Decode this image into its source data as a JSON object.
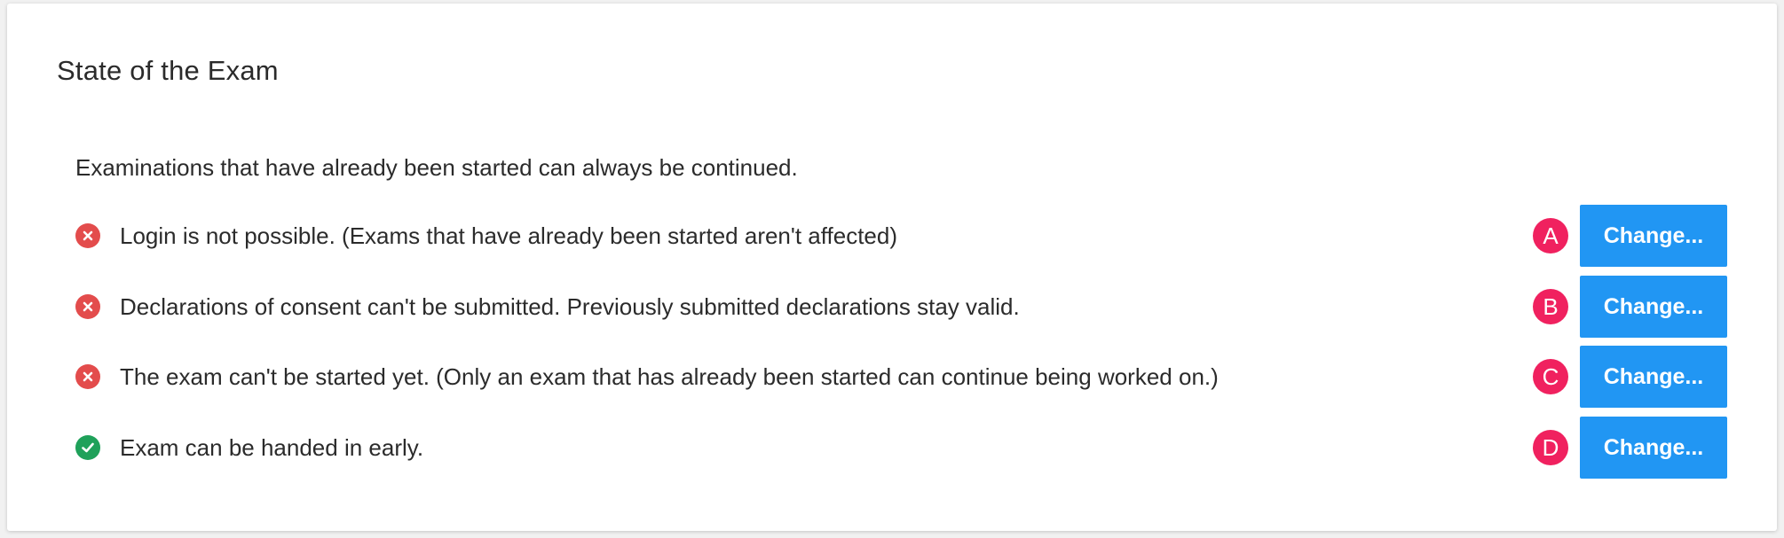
{
  "panel": {
    "title": "State of the Exam",
    "intro": "Examinations that have already been started can always be continued."
  },
  "settings": [
    {
      "status": "disabled",
      "status_icon": "x-circle-icon",
      "text": "Login is not possible. (Exams that have already been started aren't affected)",
      "badge": "A",
      "button_label": "Change..."
    },
    {
      "status": "disabled",
      "status_icon": "x-circle-icon",
      "text": "Declarations of consent can't be submitted. Previously submitted declarations stay valid.",
      "badge": "B",
      "button_label": "Change..."
    },
    {
      "status": "disabled",
      "status_icon": "x-circle-icon",
      "text": "The exam can't be started yet. (Only an exam that has already been started can continue being worked on.)",
      "badge": "C",
      "button_label": "Change..."
    },
    {
      "status": "enabled",
      "status_icon": "check-circle-icon",
      "text": "Exam can be handed in early.",
      "badge": "D",
      "button_label": "Change..."
    }
  ],
  "colors": {
    "negative": "#e34c4c",
    "positive": "#1fa15a",
    "badge": "#f0215f",
    "button": "#2196f3"
  }
}
